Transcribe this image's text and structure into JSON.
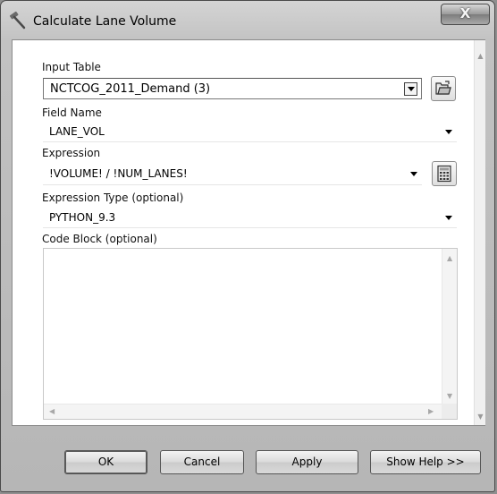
{
  "window": {
    "title": "Calculate Lane Volume",
    "close_label": "X",
    "icon": "hammer-icon"
  },
  "fields": {
    "input_table": {
      "label": "Input Table",
      "value": "NCTCOG_2011_Demand (3)",
      "browse_icon": "folder-open-icon"
    },
    "field_name": {
      "label": "Field Name",
      "value": "LANE_VOL"
    },
    "expression": {
      "label": "Expression",
      "value": "!VOLUME! / !NUM_LANES!",
      "builder_icon": "calculator-icon"
    },
    "expression_type": {
      "label": "Expression Type (optional)",
      "value": "PYTHON_9.3"
    },
    "code_block": {
      "label": "Code Block (optional)",
      "value": ""
    }
  },
  "buttons": {
    "ok": "OK",
    "cancel": "Cancel",
    "apply": "Apply",
    "show_help": "Show Help >>"
  }
}
